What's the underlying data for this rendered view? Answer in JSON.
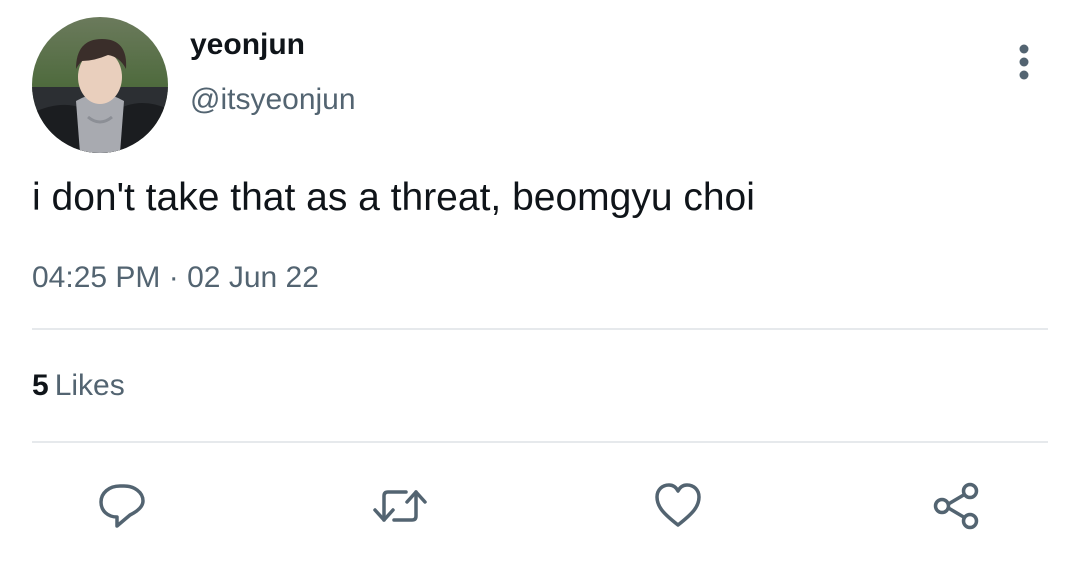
{
  "tweet": {
    "display_name": "yeonjun",
    "handle": "@itsyeonjun",
    "text": "i don't take that as a threat, beomgyu choi",
    "time": "04:25 PM",
    "separator": "·",
    "date": "02 Jun 22",
    "likes_count": "5",
    "likes_label": "Likes"
  },
  "icons": {
    "more": "more-vertical-icon",
    "reply": "reply-icon",
    "retweet": "retweet-icon",
    "like": "heart-icon",
    "share": "share-icon"
  },
  "colors": {
    "text_primary": "#0f1419",
    "text_secondary": "#536471",
    "divider": "#e6e9ec",
    "icon": "#536471"
  }
}
